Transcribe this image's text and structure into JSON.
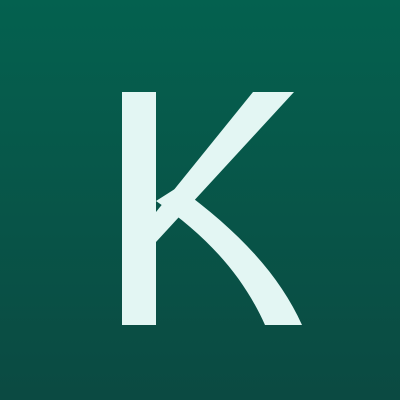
{
  "icon": {
    "letter": "K",
    "background_top": "#04614f",
    "background_bottom": "#0b4a42",
    "glyph_color": "#e3f6f3"
  }
}
